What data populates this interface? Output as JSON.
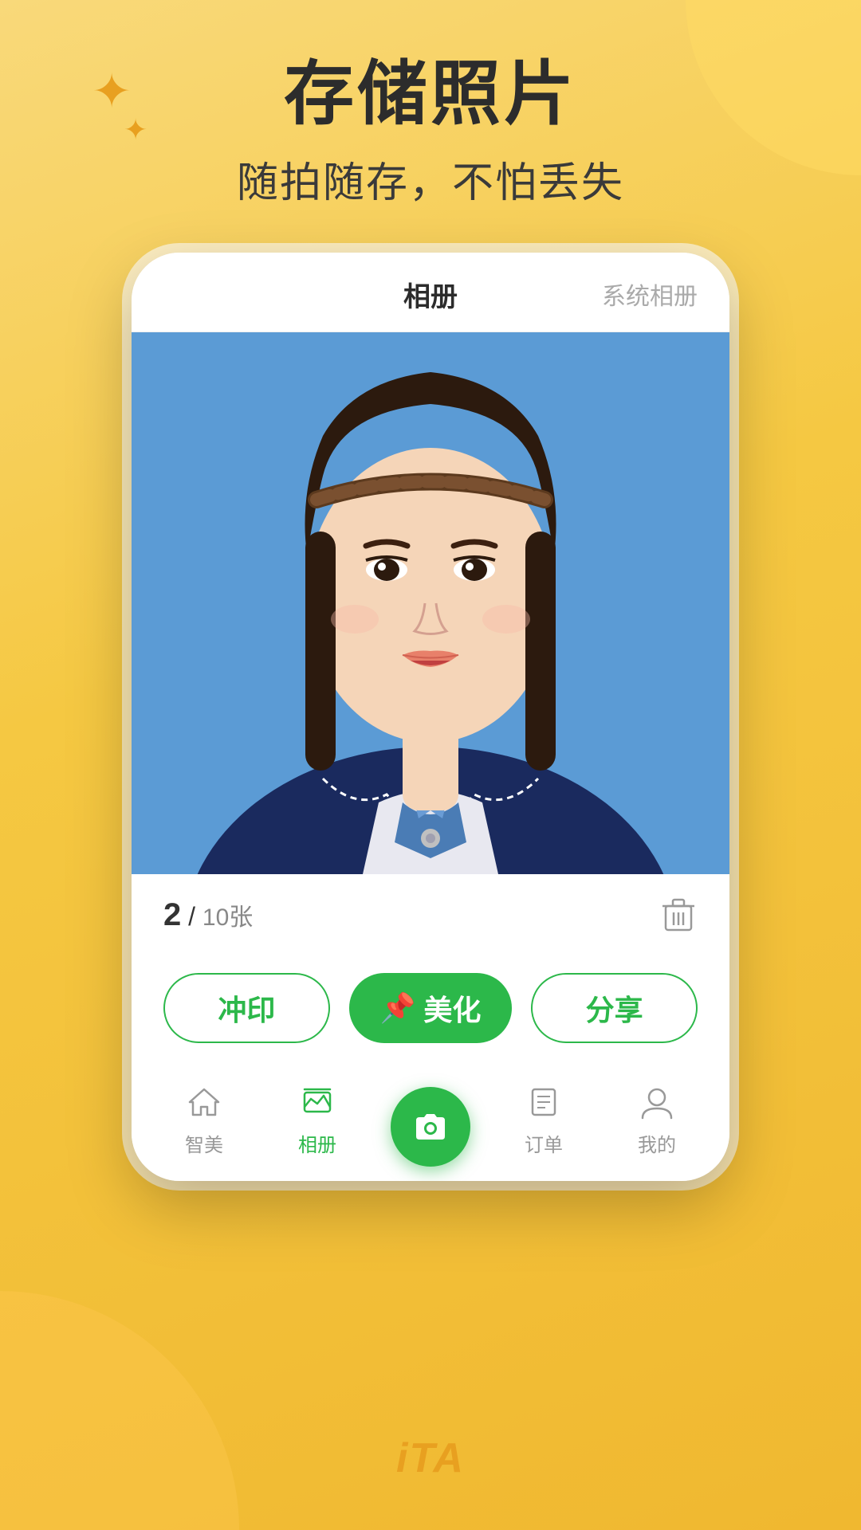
{
  "background": {
    "gradient_start": "#f9d97a",
    "gradient_end": "#f0b830"
  },
  "header": {
    "main_title": "存储照片",
    "sub_title": "随拍随存，不怕丢失"
  },
  "phone": {
    "tabs": {
      "album": "相册",
      "system": "系统相册"
    },
    "photo_info": {
      "current": "2",
      "separator": "/",
      "total": "10",
      "unit": "张"
    },
    "buttons": {
      "print": "冲印",
      "beautify": "美化",
      "share": "分享",
      "beautify_icon": "📌"
    },
    "nav": {
      "items": [
        {
          "label": "智美",
          "icon": "home",
          "active": false
        },
        {
          "label": "相册",
          "icon": "album",
          "active": true
        },
        {
          "label": "订单",
          "icon": "orders",
          "active": false
        },
        {
          "label": "我的",
          "icon": "profile",
          "active": false
        }
      ]
    }
  },
  "footer": {
    "logo": "iTA"
  },
  "sparkles": {
    "large": "✦",
    "small": "✦"
  }
}
